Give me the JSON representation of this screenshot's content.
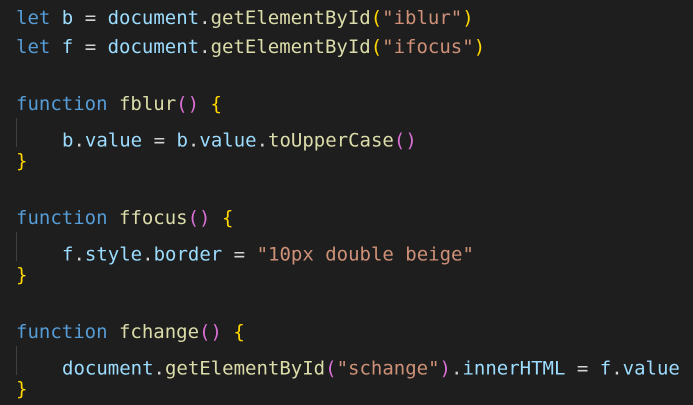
{
  "code": {
    "line1": {
      "kw": "let",
      "var": "b",
      "eq": "=",
      "obj": "document",
      "dot": ".",
      "method": "getElementById",
      "open": "(",
      "arg": "\"iblur\"",
      "close": ")"
    },
    "line2": {
      "kw": "let",
      "var": "f",
      "eq": "=",
      "obj": "document",
      "dot": ".",
      "method": "getElementById",
      "open": "(",
      "arg": "\"ifocus\"",
      "close": ")"
    },
    "line4": {
      "kw": "function",
      "name": "fblur",
      "parens": "()",
      "brace": "{"
    },
    "line5": {
      "obj": "b",
      "dot1": ".",
      "prop": "value",
      "eq": "=",
      "obj2": "b",
      "dot2": ".",
      "prop2": "value",
      "dot3": ".",
      "method": "toUpperCase",
      "parens": "()"
    },
    "line6": {
      "brace": "}"
    },
    "line8": {
      "kw": "function",
      "name": "ffocus",
      "parens": "()",
      "brace": "{"
    },
    "line9": {
      "obj": "f",
      "dot1": ".",
      "prop1": "style",
      "dot2": ".",
      "prop2": "border",
      "eq": "=",
      "str": "\"10px double beige\""
    },
    "line10": {
      "brace": "}"
    },
    "line12": {
      "kw": "function",
      "name": "fchange",
      "parens": "()",
      "brace": "{"
    },
    "line13": {
      "obj": "document",
      "dot1": ".",
      "method": "getElementById",
      "open": "(",
      "arg": "\"schange\"",
      "close": ")",
      "dot2": ".",
      "prop": "innerHTML",
      "eq": "=",
      "obj2": "f",
      "dot3": ".",
      "prop2": "value"
    },
    "line14": {
      "brace": "}"
    }
  },
  "colors": {
    "background": "#1e1e1e",
    "keyword": "#569cd6",
    "function": "#dcdcaa",
    "variable": "#9cdcfe",
    "string": "#ce9178",
    "bracket_level1": "#ffd700",
    "bracket_level2": "#da70d6"
  }
}
